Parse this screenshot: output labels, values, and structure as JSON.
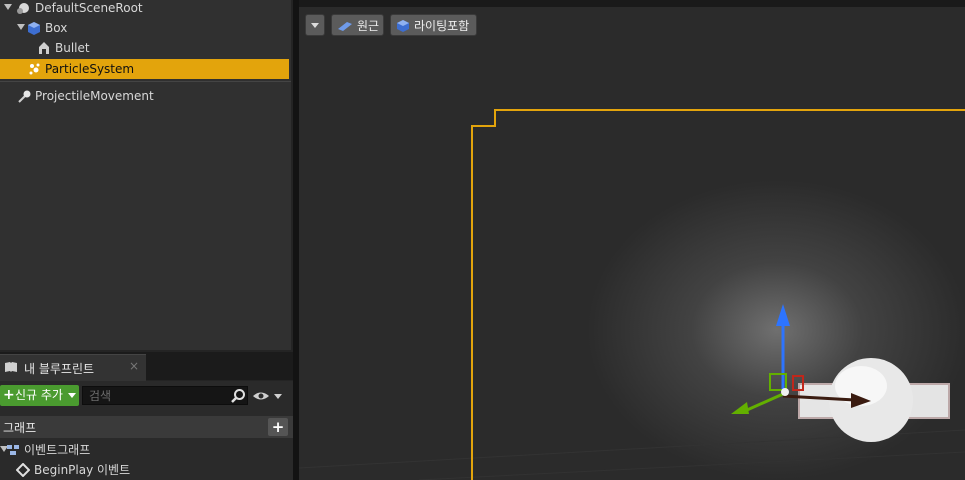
{
  "components": {
    "root": "DefaultSceneRoot",
    "box": "Box",
    "bullet": "Bullet",
    "particle": "ParticleSystem",
    "projectile": "ProjectileMovement"
  },
  "my_blueprint": {
    "tab_title": "내 블루프린트",
    "tab_close": "×",
    "add_new": "신규 추가",
    "search_placeholder": "검색",
    "graphs_header": "그래프",
    "graphs_add": "+",
    "event_graph": "이벤트그래프",
    "begin_play": "BeginPlay 이벤트"
  },
  "viewport": {
    "perspective_label": "원근",
    "lighting_label": "라이팅포함"
  },
  "colors": {
    "selection": "#e3a40c",
    "add_button": "#4a9b2f",
    "bounds_line": "#e3a40c",
    "gizmo_z": "#2d74ff",
    "gizmo_y": "#63b000",
    "gizmo_x": "#c0271b"
  },
  "icons": {
    "root": "scene-root-icon",
    "box": "box-component-icon",
    "bullet": "static-mesh-icon",
    "particle": "particle-system-icon",
    "projectile": "projectile-movement-icon",
    "blueprint_tab": "book-icon",
    "search": "search-icon",
    "visibility": "eye-icon",
    "event_graph": "graph-icon",
    "event": "event-diamond-icon"
  }
}
